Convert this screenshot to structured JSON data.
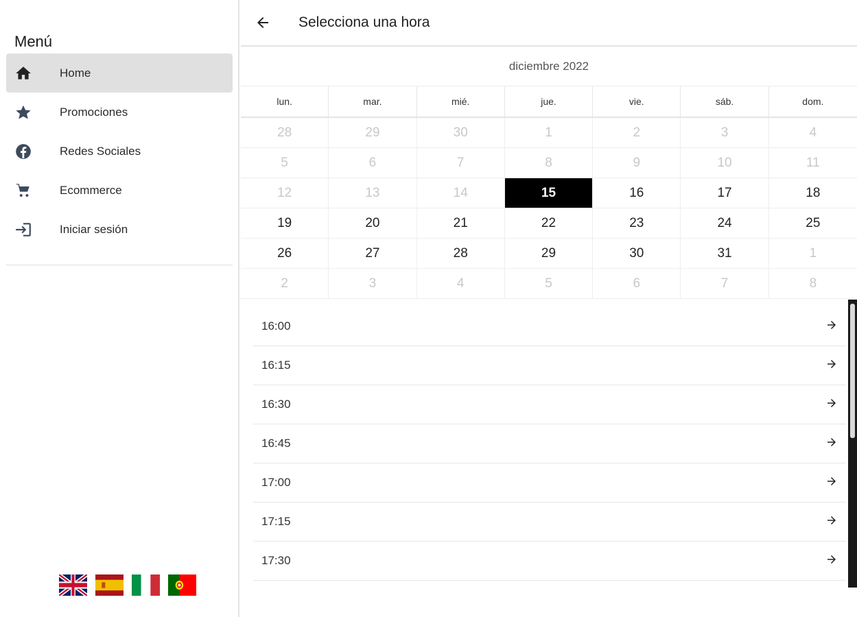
{
  "sidebar": {
    "title": "Menú",
    "items": [
      {
        "label": "Home",
        "icon": "home-icon"
      },
      {
        "label": "Promociones",
        "icon": "star-icon"
      },
      {
        "label": "Redes Sociales",
        "icon": "facebook-icon"
      },
      {
        "label": "Ecommerce",
        "icon": "cart-icon"
      },
      {
        "label": "Iniciar sesión",
        "icon": "login-icon"
      }
    ],
    "flags": [
      "uk-flag-icon",
      "spain-flag-icon",
      "italy-flag-icon",
      "portugal-flag-icon"
    ]
  },
  "header": {
    "title": "Selecciona una hora"
  },
  "calendar": {
    "month": "diciembre 2022",
    "weekdays": [
      "lun.",
      "mar.",
      "mié.",
      "jue.",
      "vie.",
      "sáb.",
      "dom."
    ],
    "days": [
      {
        "n": "28",
        "muted": true
      },
      {
        "n": "29",
        "muted": true
      },
      {
        "n": "30",
        "muted": true
      },
      {
        "n": "1",
        "muted": true
      },
      {
        "n": "2",
        "muted": true
      },
      {
        "n": "3",
        "muted": true
      },
      {
        "n": "4",
        "muted": true
      },
      {
        "n": "5",
        "muted": true
      },
      {
        "n": "6",
        "muted": true
      },
      {
        "n": "7",
        "muted": true
      },
      {
        "n": "8",
        "muted": true
      },
      {
        "n": "9",
        "muted": true
      },
      {
        "n": "10",
        "muted": true
      },
      {
        "n": "11",
        "muted": true
      },
      {
        "n": "12",
        "muted": true
      },
      {
        "n": "13",
        "muted": true
      },
      {
        "n": "14",
        "muted": true
      },
      {
        "n": "15",
        "selected": true
      },
      {
        "n": "16"
      },
      {
        "n": "17"
      },
      {
        "n": "18"
      },
      {
        "n": "19"
      },
      {
        "n": "20"
      },
      {
        "n": "21"
      },
      {
        "n": "22"
      },
      {
        "n": "23"
      },
      {
        "n": "24"
      },
      {
        "n": "25"
      },
      {
        "n": "26"
      },
      {
        "n": "27"
      },
      {
        "n": "28"
      },
      {
        "n": "29"
      },
      {
        "n": "30"
      },
      {
        "n": "31"
      },
      {
        "n": "1",
        "muted": true
      },
      {
        "n": "2",
        "muted": true
      },
      {
        "n": "3",
        "muted": true
      },
      {
        "n": "4",
        "muted": true
      },
      {
        "n": "5",
        "muted": true
      },
      {
        "n": "6",
        "muted": true
      },
      {
        "n": "7",
        "muted": true
      },
      {
        "n": "8",
        "muted": true
      }
    ]
  },
  "times": [
    "16:00",
    "16:15",
    "16:30",
    "16:45",
    "17:00",
    "17:15",
    "17:30"
  ],
  "colors": {
    "selected_bg": "#000000",
    "active_nav_bg": "#e0e0e0",
    "icon_color": "#3c4a5c",
    "muted_day": "#c8c8c8"
  }
}
